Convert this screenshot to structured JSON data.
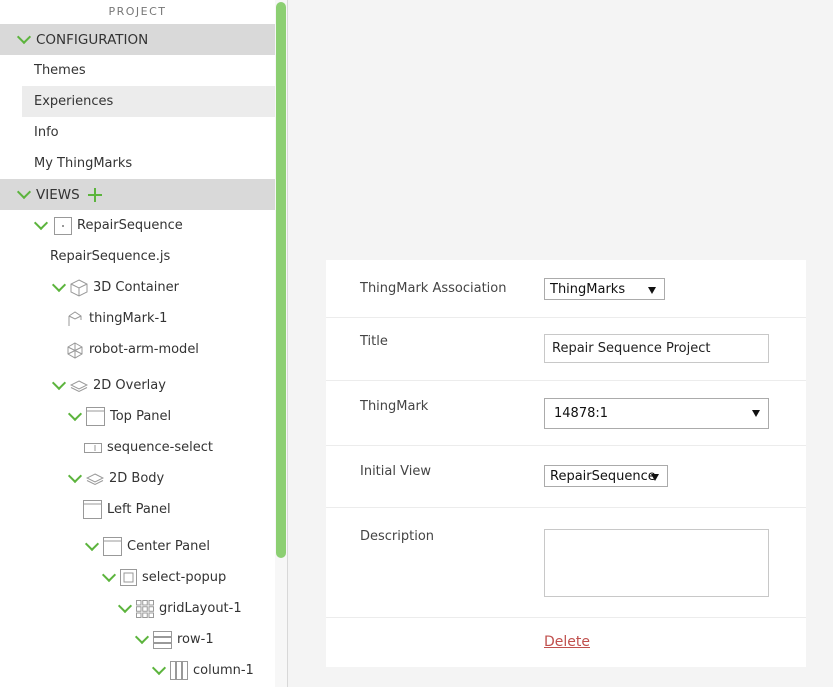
{
  "panel_title": "PROJECT",
  "configuration": {
    "header": "CONFIGURATION",
    "items": [
      "Themes",
      "Experiences",
      "Info",
      "My ThingMarks"
    ]
  },
  "views": {
    "header": "VIEWS",
    "tree": [
      {
        "label": "RepairSequence",
        "icon": "view-icon"
      },
      {
        "label": "RepairSequence.js",
        "icon": ""
      },
      {
        "label": "3D Container",
        "icon": "cube-icon"
      },
      {
        "label": "thingMark-1",
        "icon": "thingmark-icon"
      },
      {
        "label": "robot-arm-model",
        "icon": "model-icon"
      },
      {
        "label": "2D Overlay",
        "icon": "layers-icon"
      },
      {
        "label": "Top Panel",
        "icon": "panel-icon"
      },
      {
        "label": "sequence-select",
        "icon": "select-widget-icon"
      },
      {
        "label": "2D Body",
        "icon": "layers-icon"
      },
      {
        "label": "Left Panel",
        "icon": "panel-icon"
      },
      {
        "label": "Center Panel",
        "icon": "panel-icon"
      },
      {
        "label": "select-popup",
        "icon": "popup-icon"
      },
      {
        "label": "gridLayout-1",
        "icon": "grid-icon"
      },
      {
        "label": "row-1",
        "icon": "row-icon"
      },
      {
        "label": "column-1",
        "icon": "column-icon"
      }
    ]
  },
  "properties": {
    "thingmark_association": {
      "label": "ThingMark Association",
      "value": "ThingMarks"
    },
    "title": {
      "label": "Title",
      "value": "Repair Sequence Project"
    },
    "thingmark": {
      "label": "ThingMark",
      "value": "14878:1"
    },
    "initial_view": {
      "label": "Initial View",
      "value": "RepairSequence"
    },
    "description": {
      "label": "Description",
      "value": ""
    },
    "delete_label": "Delete"
  },
  "colors": {
    "accent": "#5cb43d",
    "scrollbar": "#8ccf72",
    "delete": "#c0504d"
  }
}
